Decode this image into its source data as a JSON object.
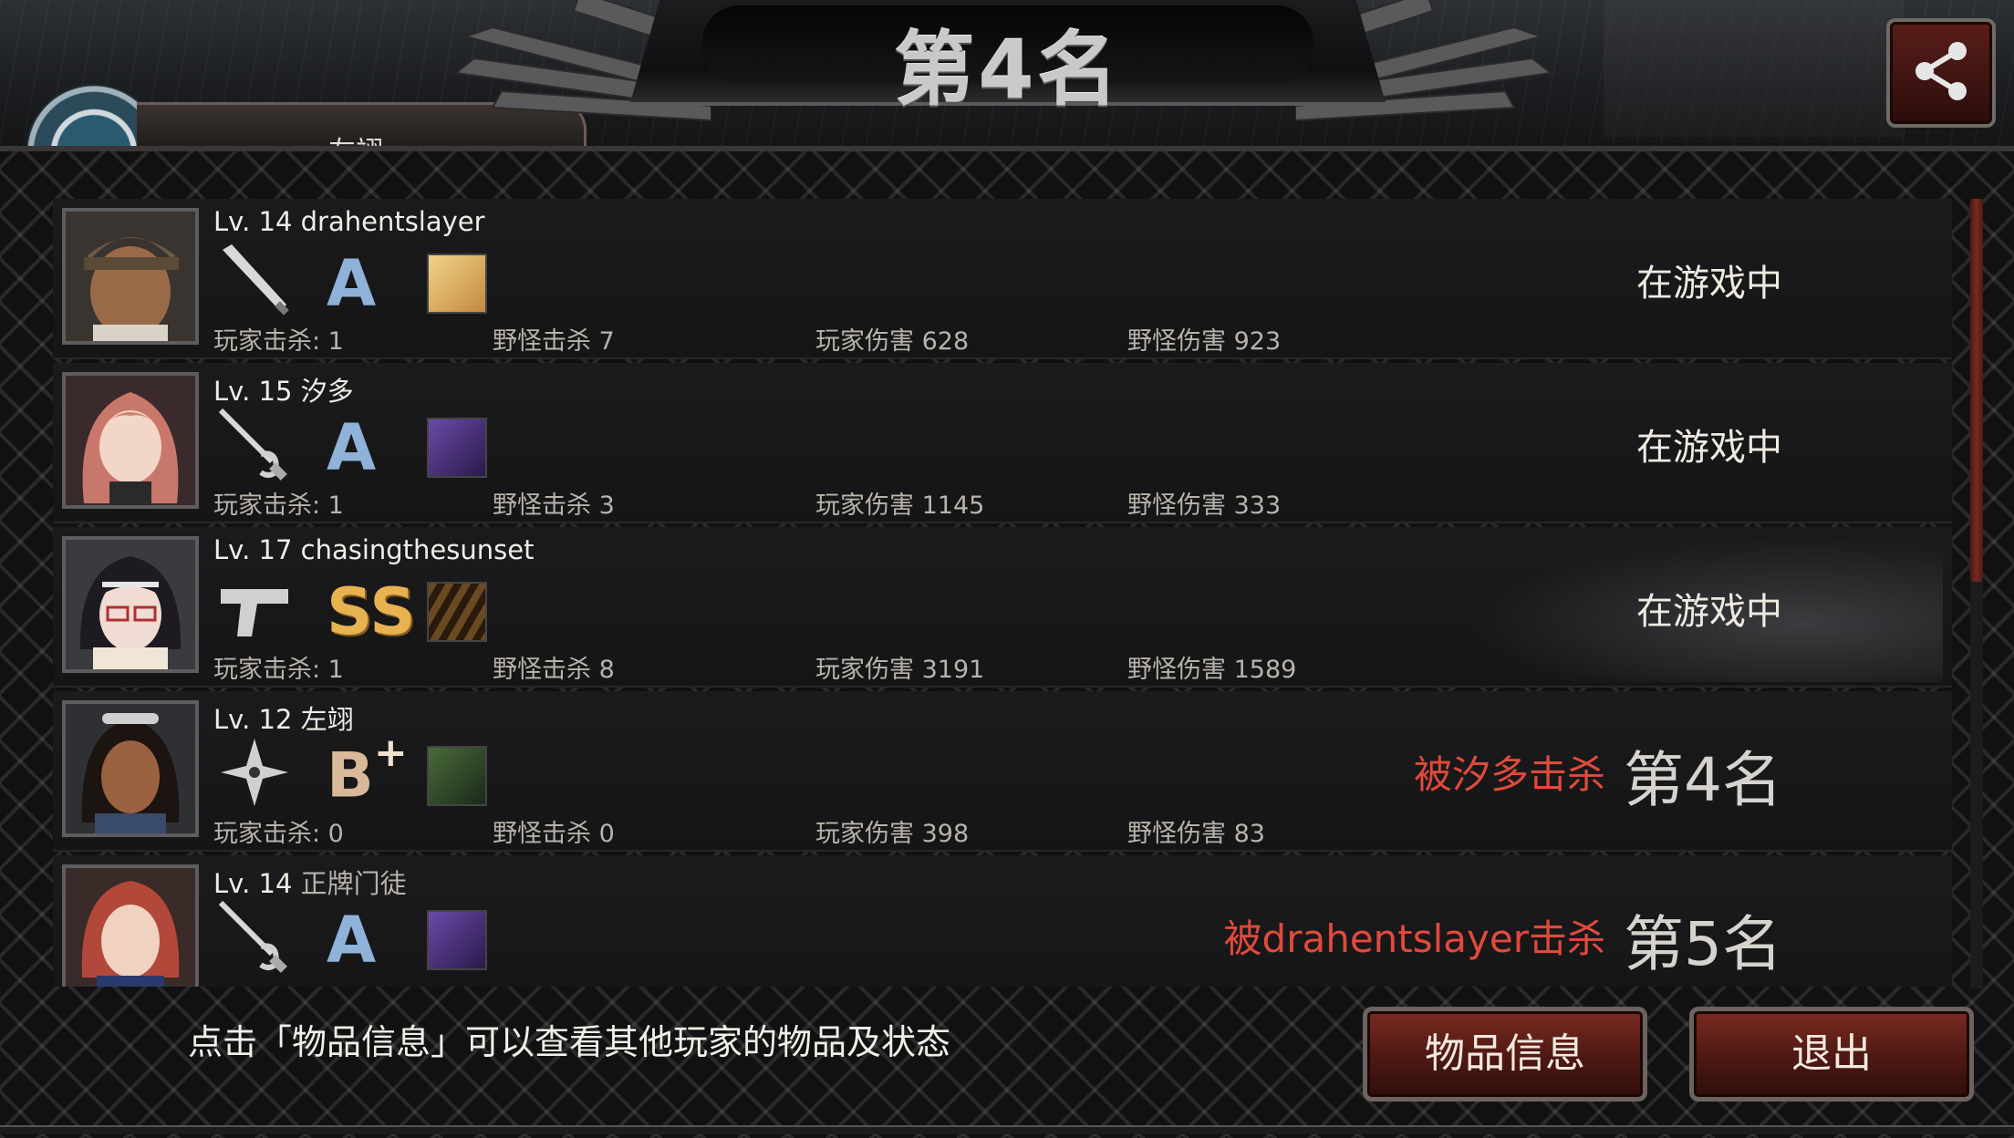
{
  "header": {
    "title": "第4名",
    "player_name_partial": "左翊"
  },
  "players": [
    {
      "level": "Lv. 14 drahentslayer",
      "weapon": "baseball-bat-icon",
      "grade": "A",
      "item": "hand-item-icon",
      "player_kills_label": "玩家击杀: 1",
      "monster_kills_label": "野怪击杀 7",
      "player_damage_label": "玩家伤害 628",
      "monster_damage_label": "野怪伤害 923",
      "status": "在游戏中"
    },
    {
      "level": "Lv. 15 汐多",
      "weapon": "rapier-icon",
      "grade": "A",
      "item": "purple-gear-icon",
      "player_kills_label": "玩家击杀: 1",
      "monster_kills_label": "野怪击杀 3",
      "player_damage_label": "玩家伤害 1145",
      "monster_damage_label": "野怪伤害 333",
      "status": "在游戏中"
    },
    {
      "level": "Lv. 17 chasingthesunset",
      "weapon": "pistol-icon",
      "grade": "SS",
      "item": "ammo-icon",
      "player_kills_label": "玩家击杀: 1",
      "monster_kills_label": "野怪击杀 8",
      "player_damage_label": "玩家伤害 3191",
      "monster_damage_label": "野怪伤害 1589",
      "status": "在游戏中"
    },
    {
      "level": "Lv. 12 左翊",
      "weapon": "shuriken-icon",
      "grade": "B",
      "grade_plus": "+",
      "item": "figure-item-icon",
      "player_kills_label": "玩家击杀: 0",
      "monster_kills_label": "野怪击杀 0",
      "player_damage_label": "玩家伤害 398",
      "monster_damage_label": "野怪伤害 83",
      "killed_by": "被汐多击杀",
      "rank": "第4名"
    },
    {
      "level": "Lv. 14",
      "level_name": "正牌门徒",
      "weapon": "rapier-icon",
      "grade": "A",
      "item": "purple-gear-icon",
      "killed_by": "被drahentslayer击杀",
      "rank": "第5名"
    }
  ],
  "footer": {
    "hint": "点击「物品信息」可以查看其他玩家的物品及状态",
    "item_info_button": "物品信息",
    "exit_button": "退出"
  },
  "colors": {
    "kill_text": "#e04a3c",
    "grade_a": "#8fb2d8",
    "grade_ss": "#e7b250",
    "button_red": "#4d1812"
  }
}
